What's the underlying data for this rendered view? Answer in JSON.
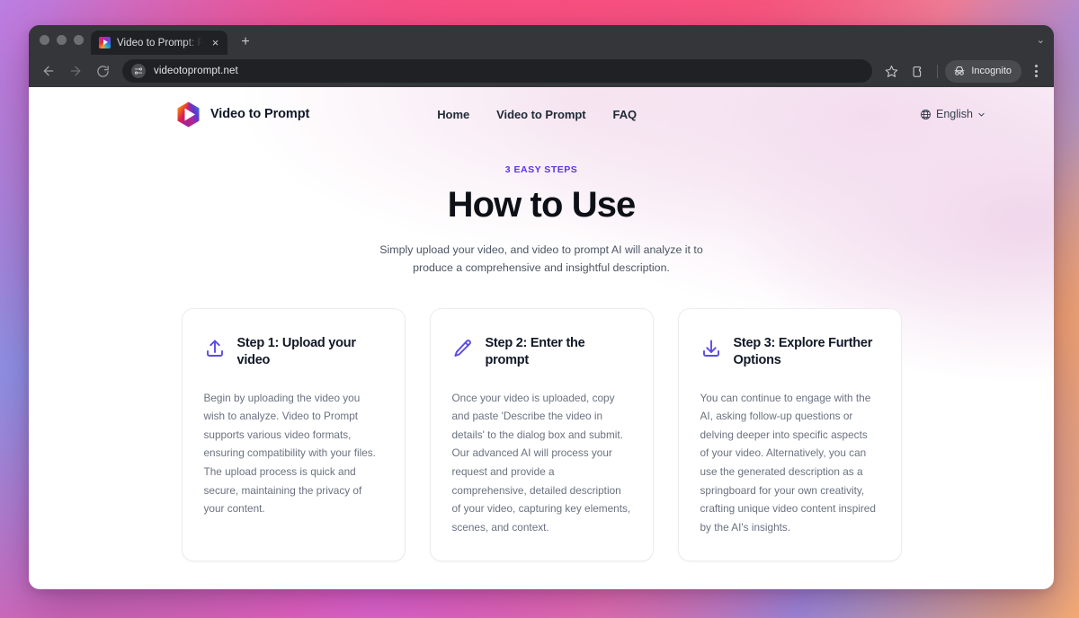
{
  "browser": {
    "tab": {
      "title": "Video to Prompt: Free AI Vide",
      "favicon": "video-prompt-logo-icon",
      "close_label": "×"
    },
    "new_tab_label": "+",
    "tabstrip_chevron": "⌄",
    "toolbar": {
      "back_label": "←",
      "forward_label": "→",
      "reload_label": "↻",
      "url": "videotoprompt.net",
      "site_settings_icon": "tune-icon",
      "bookmark_icon": "star-icon",
      "extensions_icon": "extensions-icon",
      "incognito_label": "Incognito",
      "incognito_icon": "incognito-hat-icon",
      "menu_icon": "kebab-menu-icon"
    }
  },
  "site": {
    "brand": {
      "name": "Video to Prompt",
      "logo_icon": "hexagon-play-logo-icon"
    },
    "nav": [
      {
        "label": "Home"
      },
      {
        "label": "Video to Prompt"
      },
      {
        "label": "FAQ"
      }
    ],
    "language": {
      "label": "English",
      "globe_icon": "globe-icon",
      "chevron_icon": "chevron-down-icon"
    },
    "hero": {
      "eyebrow": "3 EASY STEPS",
      "title": "How to Use",
      "subtitle": "Simply upload your video, and video to prompt AI will analyze it to produce a comprehensive and insightful description."
    },
    "cards": [
      {
        "icon": "upload-icon",
        "title": "Step 1: Upload your video",
        "body": "Begin by uploading the video you wish to analyze. Video to Prompt supports various video formats, ensuring compatibility with your files. The upload process is quick and secure, maintaining the privacy of your content."
      },
      {
        "icon": "pencil-icon",
        "title": "Step 2: Enter the prompt",
        "body": "Once your video is uploaded, copy and paste 'Describe the video in details' to the dialog box and submit. Our advanced AI will process your request and provide a comprehensive, detailed description of your video, capturing key elements, scenes, and context."
      },
      {
        "icon": "download-icon",
        "title": "Step 3: Explore Further Options",
        "body": "You can continue to engage with the AI, asking follow-up questions or delving deeper into specific aspects of your video. Alternatively, you can use the generated description as a springboard for your own creativity, crafting unique video content inspired by the AI's insights."
      }
    ]
  },
  "colors": {
    "accent_purple": "#5b34e8",
    "icon_purple": "#5b49e8",
    "heading": "#0d1117",
    "body_text": "#6b7280",
    "card_border": "#ececf1",
    "browser_chrome": "#35363a",
    "omnibox_bg": "#202124"
  }
}
